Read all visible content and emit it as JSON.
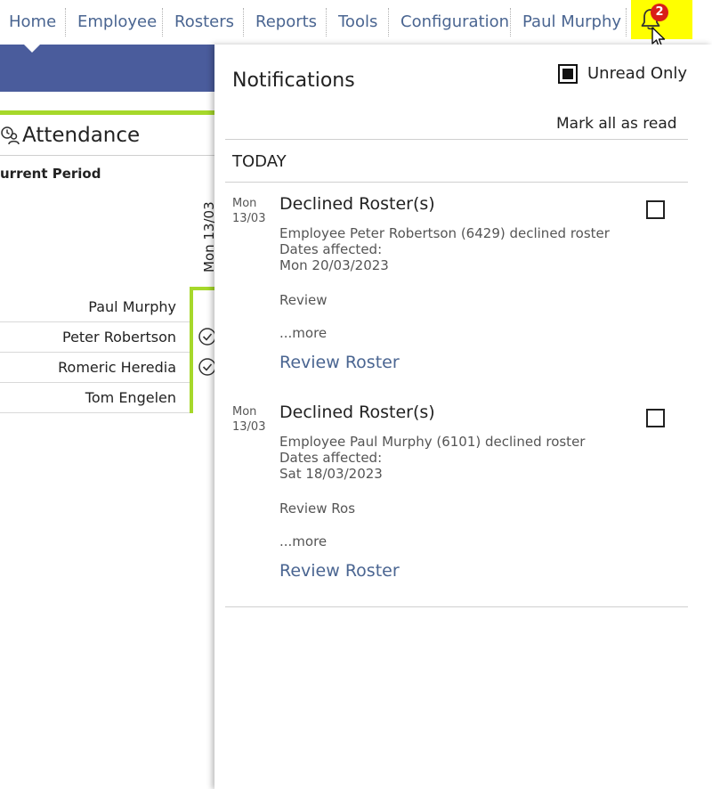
{
  "nav": {
    "items": [
      {
        "label": "Home"
      },
      {
        "label": "Employee"
      },
      {
        "label": "Rosters"
      },
      {
        "label": "Reports"
      },
      {
        "label": "Tools"
      },
      {
        "label": "Configuration"
      },
      {
        "label": "Paul Murphy"
      }
    ],
    "notification_count": "2",
    "bell_highlight_color": "#ffff00",
    "badge_color": "#d91e18",
    "icons": [
      "bell-icon",
      "mouse-cursor-icon"
    ]
  },
  "theme": {
    "nav_text_color": "#4a6591",
    "band_color": "#4a5c9c",
    "accent_green": "#a6d82a"
  },
  "attendance": {
    "title": "Attendance",
    "title_icon": "attendance-person-icon",
    "period_label": "urrent Period",
    "date_header": "Mon 13/03",
    "employees": [
      {
        "name": "Paul Murphy",
        "status_icon": ""
      },
      {
        "name": "Peter Robertson",
        "status_icon": "check-circle-icon"
      },
      {
        "name": "Romeric Heredia",
        "status_icon": "check-circle-icon"
      },
      {
        "name": "Tom Engelen",
        "status_icon": ""
      }
    ]
  },
  "notifications": {
    "title": "Notifications",
    "unread_only_label": "Unread Only",
    "unread_only_checked": true,
    "mark_all_label": "Mark all as read",
    "group_label": "TODAY",
    "items": [
      {
        "day": "Mon",
        "date": "13/03",
        "title": "Declined Roster(s)",
        "line1": "Employee Peter Robertson (6429) declined roster",
        "line2": "Dates affected:",
        "line3": "Mon 20/03/2023",
        "review_text": "Review",
        "more_label": "...more",
        "link_label": "Review Roster",
        "checked": false
      },
      {
        "day": "Mon",
        "date": "13/03",
        "title": "Declined Roster(s)",
        "line1": "Employee Paul Murphy (6101) declined roster",
        "line2": "Dates affected:",
        "line3": "Sat 18/03/2023",
        "review_text": "Review Ros",
        "more_label": "...more",
        "link_label": "Review Roster",
        "checked": false
      }
    ]
  }
}
